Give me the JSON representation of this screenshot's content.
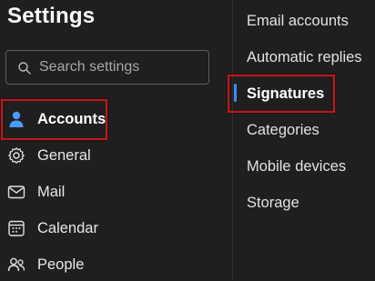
{
  "header": {
    "title": "Settings"
  },
  "search": {
    "placeholder": "Search settings"
  },
  "nav": {
    "items": [
      {
        "label": "Accounts",
        "icon": "person-icon",
        "active": true
      },
      {
        "label": "General",
        "icon": "gear-icon"
      },
      {
        "label": "Mail",
        "icon": "mail-icon"
      },
      {
        "label": "Calendar",
        "icon": "calendar-icon"
      },
      {
        "label": "People",
        "icon": "people-icon"
      }
    ]
  },
  "accounts_menu": {
    "items": [
      {
        "label": "Email accounts"
      },
      {
        "label": "Automatic replies"
      },
      {
        "label": "Signatures",
        "active": true
      },
      {
        "label": "Categories"
      },
      {
        "label": "Mobile devices"
      },
      {
        "label": "Storage"
      }
    ]
  },
  "colors": {
    "background": "#1f1f1f",
    "accent": "#3b8cff",
    "highlight_box": "#c8151b",
    "text": "#ffffff"
  }
}
